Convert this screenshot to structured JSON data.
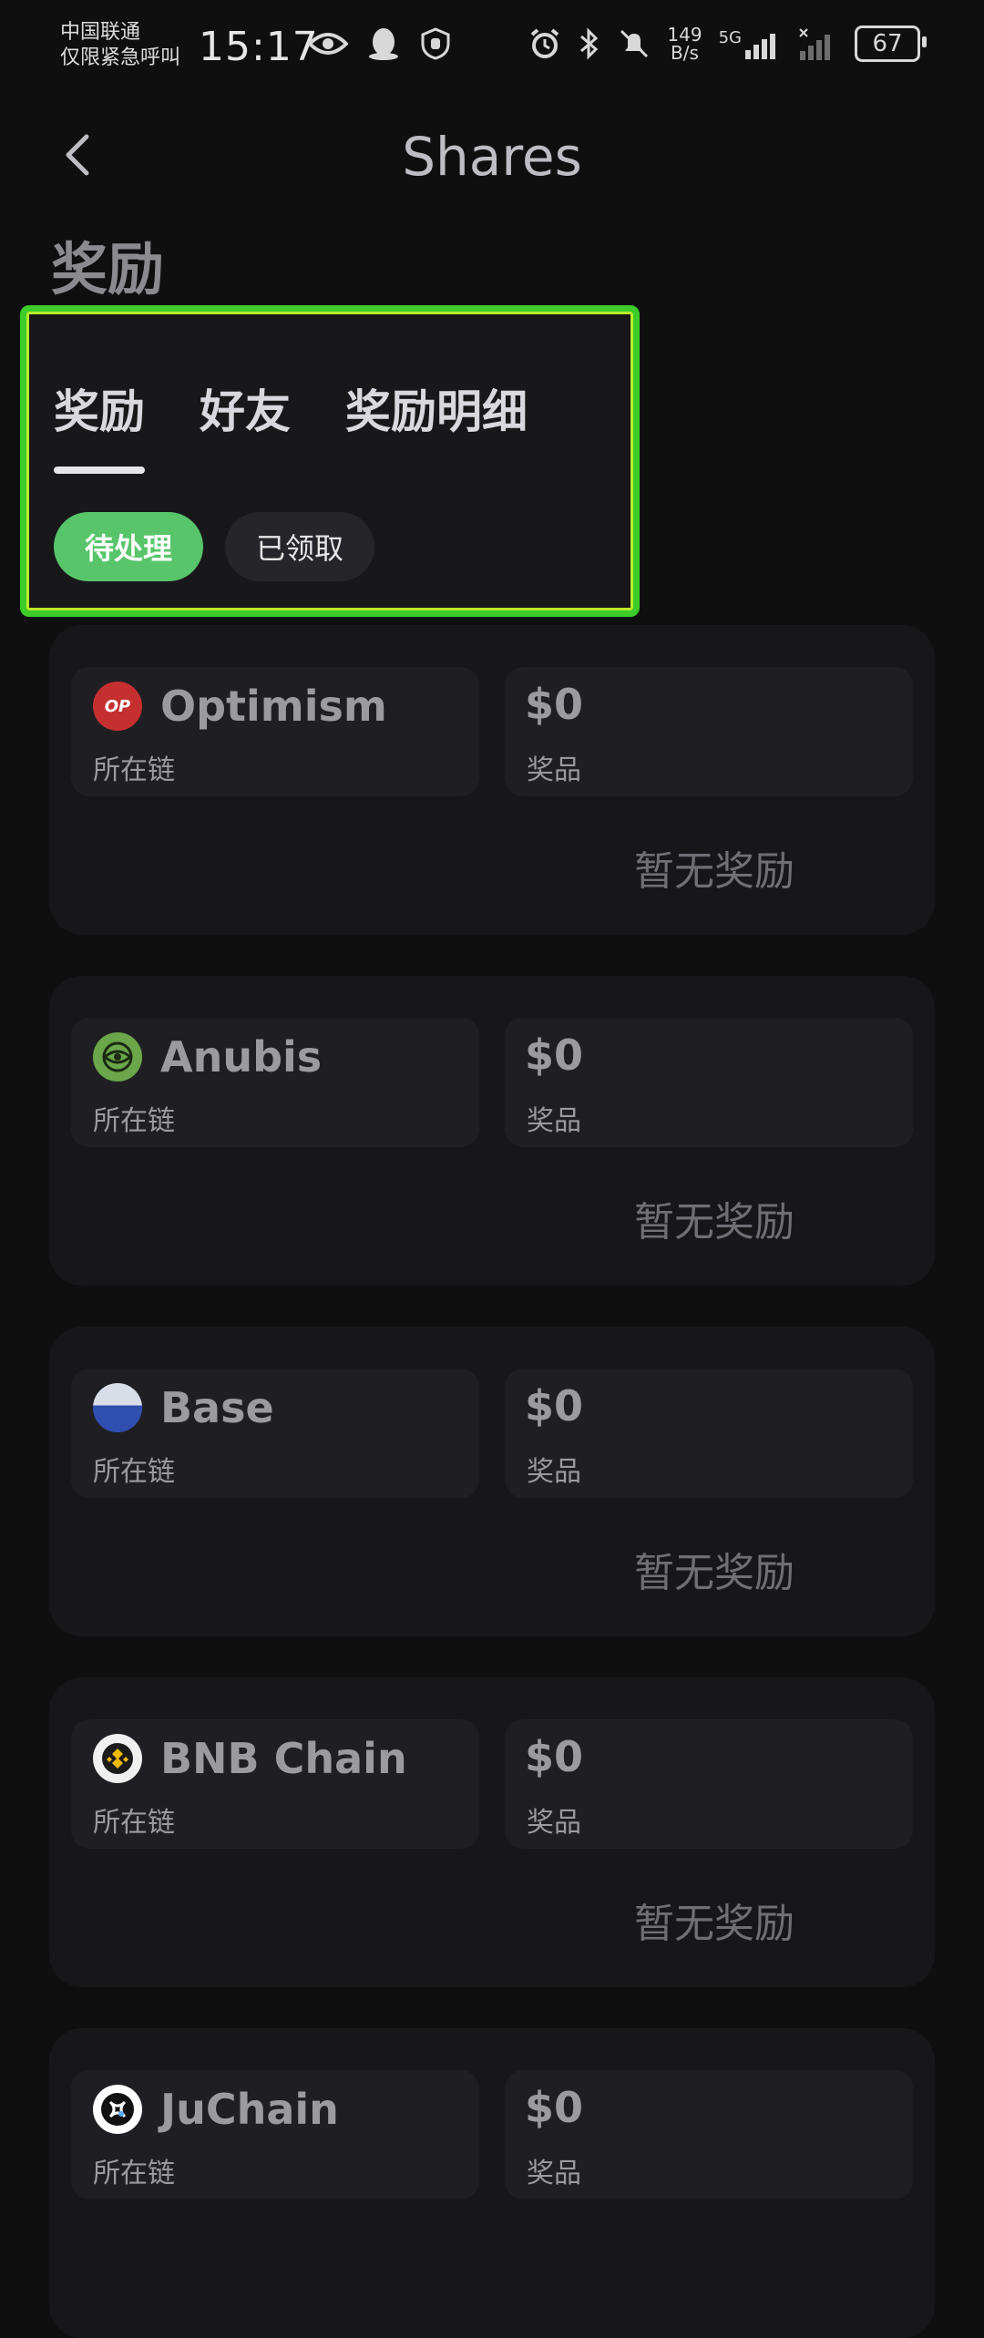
{
  "status": {
    "carrier_line1": "中国联通",
    "carrier_line2": "仅限紧急呼叫",
    "time": "15:17",
    "net_speed_value": "149",
    "net_speed_unit": "B/s",
    "network": "5G",
    "battery": "67"
  },
  "header": {
    "title": "Shares"
  },
  "section_title": "奖励",
  "tabs": [
    {
      "label": "奖励",
      "active": true
    },
    {
      "label": "好友",
      "active": false
    },
    {
      "label": "奖励明细",
      "active": false
    }
  ],
  "filters": [
    {
      "label": "待处理",
      "selected": true
    },
    {
      "label": "已领取",
      "selected": false
    }
  ],
  "cards": [
    {
      "chain": "Optimism",
      "chain_label": "所在链",
      "amount": "$0",
      "amount_label": "奖品",
      "empty": "暂无奖励",
      "icon": "optimism-icon",
      "icon_color": "#c62f2f"
    },
    {
      "chain": "Anubis",
      "chain_label": "所在链",
      "amount": "$0",
      "amount_label": "奖品",
      "empty": "暂无奖励",
      "icon": "anubis-icon",
      "icon_color": "#6ba64a"
    },
    {
      "chain": "Base",
      "chain_label": "所在链",
      "amount": "$0",
      "amount_label": "奖品",
      "empty": "暂无奖励",
      "icon": "base-icon",
      "icon_color": "#2f4fb0"
    },
    {
      "chain": "BNB Chain",
      "chain_label": "所在链",
      "amount": "$0",
      "amount_label": "奖品",
      "empty": "暂无奖励",
      "icon": "bnb-chain-icon",
      "icon_color": "#f0b90b"
    },
    {
      "chain": "JuChain",
      "chain_label": "所在链",
      "amount": "$0",
      "amount_label": "奖品",
      "empty": "",
      "icon": "juchain-icon",
      "icon_color": "#ffffff"
    }
  ],
  "colors": {
    "accent_green": "#58c56a",
    "highlight_border": "#3dcc2a",
    "background": "#0f0f10",
    "card": "#17171a"
  }
}
